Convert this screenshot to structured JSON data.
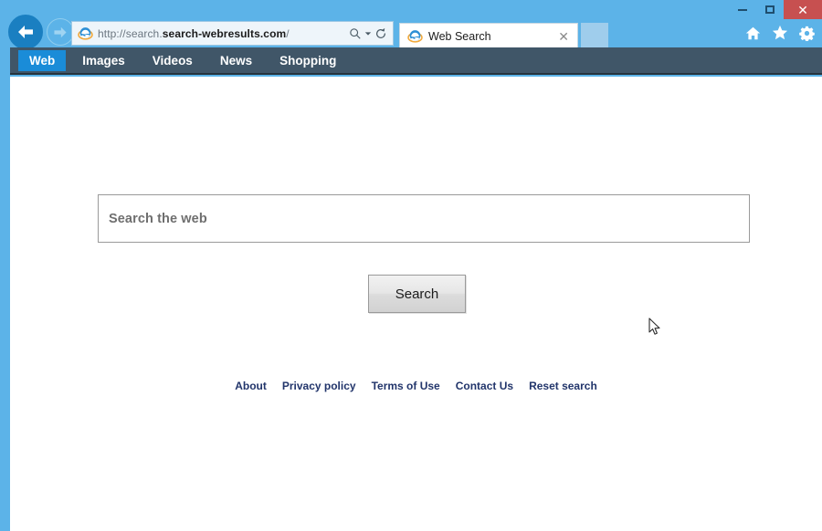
{
  "window": {
    "minimize_label": "—",
    "maximize_label": "□",
    "close_label": "✕"
  },
  "browser": {
    "back_icon": "back-arrow-icon",
    "forward_icon": "forward-arrow-icon",
    "address": {
      "prefix": "http://search.",
      "domain": "search-webresults.com",
      "suffix": "/",
      "search_icon": "magnifier-icon",
      "dropdown_icon": "chevron-down-icon",
      "refresh_icon": "refresh-icon"
    },
    "tab": {
      "title": "Web Search",
      "favicon": "internet-explorer-icon",
      "close_label": "✕"
    },
    "new_tab_label": "",
    "toolbar_icons": [
      "home-icon",
      "favorites-star-icon",
      "settings-gear-icon"
    ]
  },
  "site_nav": {
    "items": [
      {
        "label": "Web",
        "active": true
      },
      {
        "label": "Images",
        "active": false
      },
      {
        "label": "Videos",
        "active": false
      },
      {
        "label": "News",
        "active": false
      },
      {
        "label": "Shopping",
        "active": false
      }
    ],
    "active_bg": "#1a8cd8",
    "bar_bg": "#405668"
  },
  "search": {
    "value": "",
    "placeholder": "Search the web",
    "button_label": "Search"
  },
  "footer": {
    "links": [
      {
        "label": "About"
      },
      {
        "label": "Privacy policy"
      },
      {
        "label": "Terms of Use"
      },
      {
        "label": "Contact Us"
      },
      {
        "label": "Reset search"
      }
    ],
    "link_color": "#22356b"
  },
  "theme": {
    "titlebar_bg": "#5cb3e8",
    "close_btn_bg": "#c75050",
    "page_bg": "#ffffff"
  }
}
